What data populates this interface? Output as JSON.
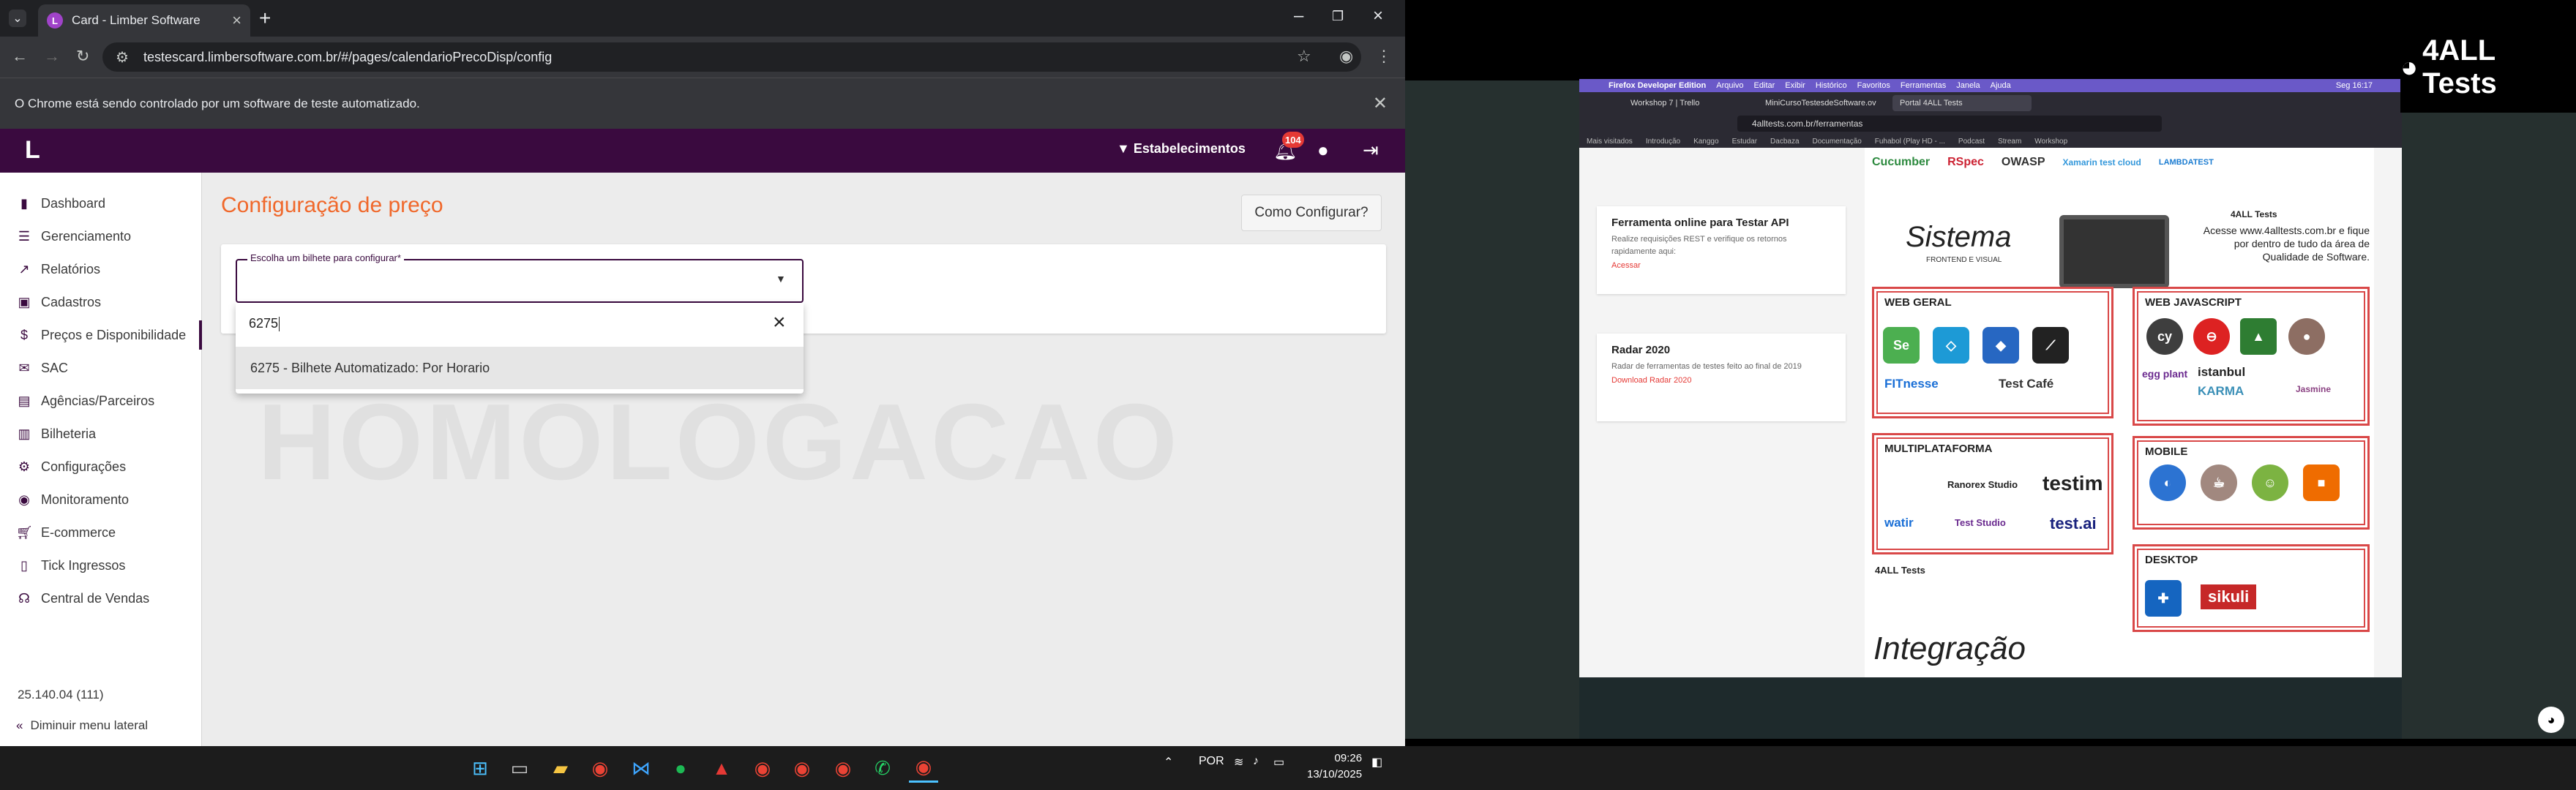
{
  "browser": {
    "tab_title": "Card - Limber Software",
    "tab_favicon": "L",
    "url": "testescard.limbersoftware.com.br/#/pages/calendarioPrecoDisp/config",
    "infobar_text": "O Chrome está sendo controlado por um software de teste automatizado."
  },
  "app": {
    "logo": "L",
    "establishments": "Estabelecimentos",
    "notifications_count": "104",
    "accent": "#3a0a3f",
    "title_color": "#f0682b"
  },
  "sidebar": {
    "items": [
      {
        "label": "Dashboard",
        "icon": "bar-chart-icon"
      },
      {
        "label": "Gerenciamento",
        "icon": "list-icon"
      },
      {
        "label": "Relatórios",
        "icon": "trend-icon"
      },
      {
        "label": "Cadastros",
        "icon": "ticket-icon"
      },
      {
        "label": "Preços e Disponibilidade",
        "icon": "dollar-icon"
      },
      {
        "label": "SAC",
        "icon": "mail-icon"
      },
      {
        "label": "Agências/Parceiros",
        "icon": "badge-icon"
      },
      {
        "label": "Bilheteria",
        "icon": "document-icon"
      },
      {
        "label": "Configurações",
        "icon": "gear-icon"
      },
      {
        "label": "Monitoramento",
        "icon": "eye-icon"
      },
      {
        "label": "E-commerce",
        "icon": "cart-icon"
      },
      {
        "label": "Tick Ingressos",
        "icon": "phone-icon"
      },
      {
        "label": "Central de Vendas",
        "icon": "headset-icon"
      }
    ],
    "version": "25.140.04 (111)",
    "collapse_label": "Diminuir menu lateral"
  },
  "main": {
    "title": "Configuração de preço",
    "how_to_button": "Como Configurar?",
    "select_label": "Escolha um bilhete para configurar*",
    "search_value": "6275",
    "option": "6275 - Bilhete Automatizado: Por Horario",
    "watermark": "HOMOLOGACAO"
  },
  "taskbar": {
    "lang": "POR",
    "time": "09:26",
    "date": "13/10/2025"
  },
  "shared_screen": {
    "menubar": [
      "Firefox Developer Edition",
      "Arquivo",
      "Editar",
      "Exibir",
      "Histórico",
      "Favoritos",
      "Ferramentas",
      "Janela",
      "Ajuda"
    ],
    "menubar_right": "Seg 16:17",
    "tabs": [
      "Workshop 7 | Trello",
      "MiniCursoTestesdeSoftware.ov",
      "Portal 4ALL Tests"
    ],
    "url": "4alltests.com.br/ferramentas",
    "bookmarks": [
      "Mais visitados",
      "Introdução",
      "Kanggo",
      "Estudar",
      "Dacbaza",
      "Documentação",
      "Fuhabol (Play HD - ...",
      "Podcast",
      "Stream",
      "Workshop"
    ],
    "card1_title": "Ferramenta online para Testar API",
    "card1_text": "Realize requisições REST e verifique os retornos rapidamente aqui:",
    "card1_link": "Acessar",
    "card2_title": "Radar 2020",
    "card2_text": "Radar de ferramentas de testes feito ao final de 2019",
    "card2_link": "Download Radar 2020",
    "brand": "4ALL Tests",
    "graphic": {
      "top_tools": [
        "Cucumber",
        "RSpec",
        "OWASP",
        "Xamarin test cloud",
        "LAMBDATEST"
      ],
      "sistema": "Sistema",
      "sistema_sub": "FRONTEND E VISUAL",
      "promo_brand": "4ALL Tests",
      "promo_text": "Acesse www.4alltests.com.br e fique por dentro de tudo da área de Qualidade de Software.",
      "web_geral": "WEB GERAL",
      "web_js": "WEB JAVASCRIPT",
      "multi": "MULTIPLATAFORMA",
      "mobile": "MOBILE",
      "desktop": "DESKTOP",
      "integracao": "Integração",
      "footer_brand": "4ALL Tests",
      "tools_web": [
        "Se",
        "FITnesse",
        "Test Café"
      ],
      "tools_js": [
        "cy",
        "egg plant",
        "istanbul",
        "KARMA",
        "Jasmine"
      ],
      "tools_multi": [
        "Ranorex Studio",
        "testim",
        "watir",
        "Test Studio",
        "test.ai"
      ],
      "tools_desktop": [
        "sikuli"
      ]
    }
  }
}
